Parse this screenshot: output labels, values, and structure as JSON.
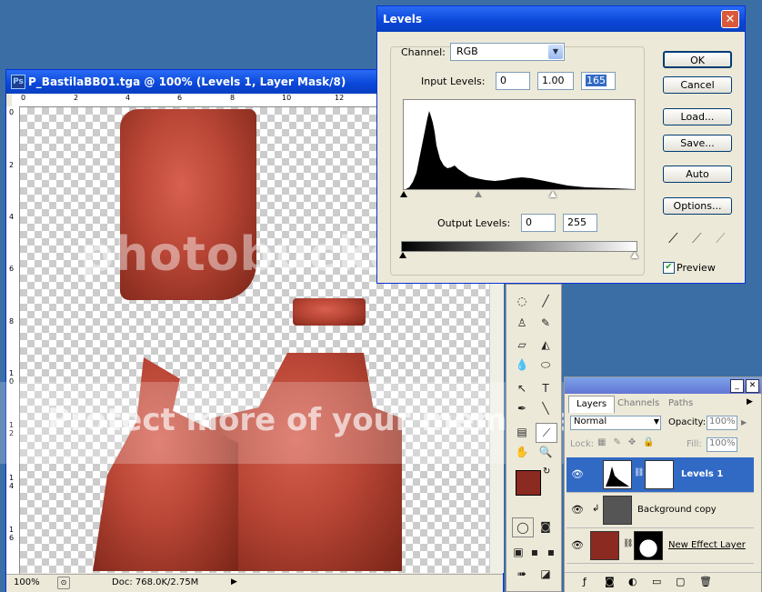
{
  "document": {
    "title": "P_BastilaBB01.tga @ 100% (Levels 1, Layer Mask/8)",
    "ruler_top_labels": [
      "0",
      "2",
      "4",
      "6",
      "8",
      "10",
      "12"
    ],
    "ruler_left_labels": [
      "0",
      "2",
      "4",
      "6",
      "8",
      "1\n0",
      "1\n2",
      "1\n4",
      "1\n6"
    ],
    "zoom": "100%",
    "doc_size": "Doc: 768.0K/2.75M"
  },
  "watermark": {
    "brand": "photobucket",
    "text": "Protect more of your memories"
  },
  "levels": {
    "title": "Levels",
    "channel_label": "Channel:",
    "channel_value": "RGB",
    "input_label": "Input Levels:",
    "input_black": "0",
    "input_gamma": "1.00",
    "input_white": "165",
    "output_label": "Output Levels:",
    "output_black": "0",
    "output_white": "255",
    "buttons": {
      "ok": "OK",
      "cancel": "Cancel",
      "load": "Load...",
      "save": "Save...",
      "auto": "Auto",
      "options": "Options..."
    },
    "preview_label": "Preview",
    "preview_checked": true
  },
  "layers_panel": {
    "tabs": [
      "Layers",
      "Channels",
      "Paths"
    ],
    "blend_mode": "Normal",
    "opacity_label": "Opacity:",
    "opacity_value": "100%",
    "lock_label": "Lock:",
    "fill_label": "Fill:",
    "fill_value": "100%",
    "layers": [
      {
        "name": "Levels 1",
        "selected": true
      },
      {
        "name": "Background copy",
        "selected": false
      },
      {
        "name": "New Effect Layer",
        "selected": false
      }
    ]
  },
  "colors": {
    "foreground": "#8b2a20",
    "background": "#5a1410",
    "title_bar": "#0a46d8",
    "selection": "#316ac5"
  }
}
